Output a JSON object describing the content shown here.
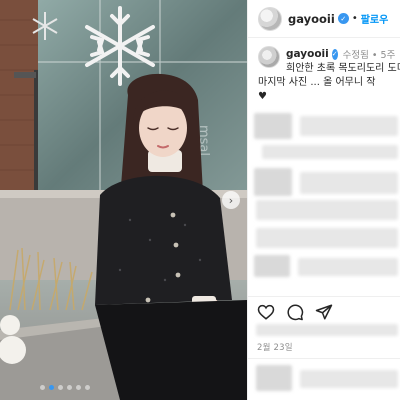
{
  "header": {
    "username": "gayooii",
    "separator": "•",
    "follow_label": "팔로우",
    "verified_icon": "verified-badge-icon"
  },
  "caption": {
    "username": "gayooii",
    "edited": "수정됨",
    "separator": "•",
    "time_ago": "5주",
    "line1": "희안한 초록 목도리도리 도미",
    "line2": "마지막 사진 ... 올 어무니 작",
    "heart": "♥"
  },
  "actions": {
    "like_icon": "heart-icon",
    "comment_icon": "comment-icon",
    "share_icon": "share-icon"
  },
  "date": "2월 23일",
  "carousel": {
    "next_arrow": "›",
    "slides_total": 6,
    "active_index": 1
  },
  "colors": {
    "accent": "#0095f6",
    "verified": "#3897f0",
    "muted": "#8e8e8e",
    "text": "#262626"
  }
}
